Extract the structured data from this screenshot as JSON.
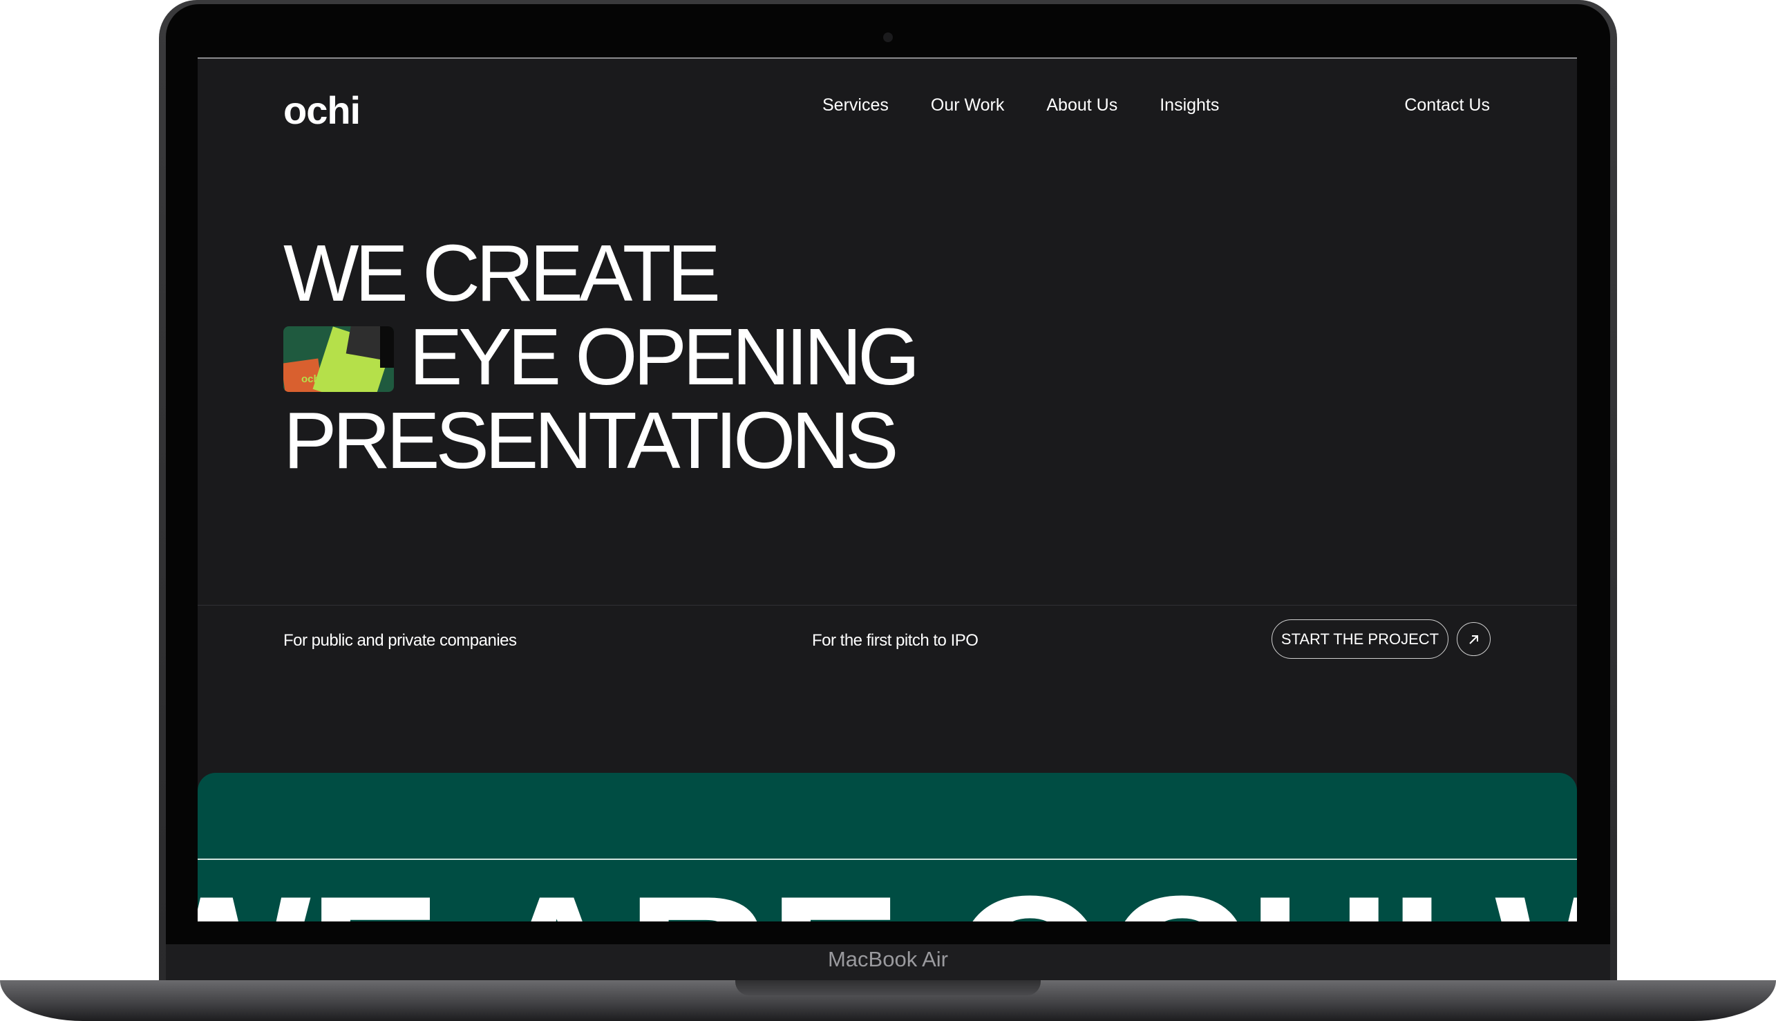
{
  "device": {
    "label": "MacBook Air"
  },
  "brand": {
    "logo": "ochi"
  },
  "nav": {
    "links": [
      "Services",
      "Our Work",
      "About Us",
      "Insights"
    ],
    "contact": "Contact Us"
  },
  "hero": {
    "line1": "WE CREATE",
    "line2": "EYE OPENING",
    "line3": "PRESENTATIONS",
    "thumb_text_1": "ochi",
    "thumb_text_2": "ochi"
  },
  "subbar": {
    "tag1": "For public and private companies",
    "tag2": "For the first pitch to IPO",
    "cta_label": "START THE PROJECT",
    "cta_icon": "arrow-up-right-icon"
  },
  "marquee": {
    "text": "WE ARE OCHI WE ARE OCHI"
  },
  "colors": {
    "screen_bg": "#1a1a1c",
    "green_panel": "#004d43",
    "text": "#ffffff"
  }
}
